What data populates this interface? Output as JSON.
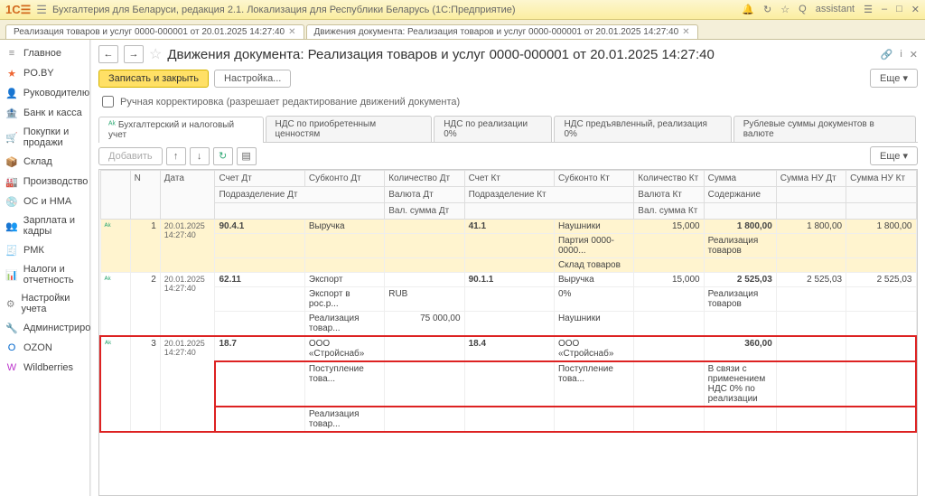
{
  "title": "Бухгалтерия для Беларуси, редакция 2.1. Локализация для Республики Беларусь  (1С:Предприятие)",
  "assistant": "assistant",
  "tabs": [
    "Реализация товаров и услуг 0000-000001 от 20.01.2025 14:27:40",
    "Движения документа: Реализация товаров и услуг 0000-000001 от 20.01.2025 14:27:40"
  ],
  "sidebar": [
    {
      "ico": "≡",
      "label": "Главное",
      "c": "#888"
    },
    {
      "ico": "★",
      "label": "PO.BY",
      "c": "#e63"
    },
    {
      "ico": "👤",
      "label": "Руководителю",
      "c": "#c6a"
    },
    {
      "ico": "🏦",
      "label": "Банк и касса",
      "c": "#f90"
    },
    {
      "ico": "🛒",
      "label": "Покупки и продажи",
      "c": "#3a7"
    },
    {
      "ico": "📦",
      "label": "Склад",
      "c": "#a66"
    },
    {
      "ico": "🏭",
      "label": "Производство",
      "c": "#888"
    },
    {
      "ico": "💿",
      "label": "ОС и НМА",
      "c": "#d44"
    },
    {
      "ico": "👥",
      "label": "Зарплата и кадры",
      "c": "#39c"
    },
    {
      "ico": "🧾",
      "label": "РМК",
      "c": "#6a3"
    },
    {
      "ico": "📊",
      "label": "Налоги и отчетность",
      "c": "#e63"
    },
    {
      "ico": "⚙",
      "label": "Настройки учета",
      "c": "#888"
    },
    {
      "ico": "🔧",
      "label": "Администрирование",
      "c": "#888"
    },
    {
      "ico": "O",
      "label": "OZON",
      "c": "#06c"
    },
    {
      "ico": "W",
      "label": "Wildberries",
      "c": "#b3c"
    }
  ],
  "doc_title": "Движения документа: Реализация товаров и услуг 0000-000001 от 20.01.2025 14:27:40",
  "btn_save": "Записать и закрыть",
  "btn_settings": "Настройка...",
  "btn_more": "Еще",
  "chk_label": "Ручная корректировка (разрешает редактирование движений документа)",
  "subtabs": [
    "Бухгалтерский и налоговый учет",
    "НДС по приобретенным ценностям",
    "НДС по реализации 0%",
    "НДС предъявленный, реализация 0%",
    "Рублевые суммы документов в валюте"
  ],
  "btn_add": "Добавить",
  "headers": {
    "n": "N",
    "date": "Дата",
    "acc_dt": "Счет Дт",
    "sub_dt": "Субконто Дт",
    "qty_dt": "Количество Дт",
    "acc_kt": "Счет Кт",
    "sub_kt": "Субконто Кт",
    "qty_kt": "Количество Кт",
    "sum": "Сумма",
    "sum_nu_dt": "Сумма НУ Дт",
    "sum_nu_kt": "Сумма НУ Кт",
    "podr_dt": "Подразделение Дт",
    "val_dt": "Валюта Дт",
    "valsum_dt": "Вал. сумма Дт",
    "podr_kt": "Подразделение Кт",
    "val_kt": "Валюта Кт",
    "valsum_kt": "Вал. сумма Кт",
    "content": "Содержание"
  },
  "rows": [
    {
      "n": "1",
      "date": "20.01.2025 14:27:40",
      "acc_dt": "90.4.1",
      "sub_dt": [
        "Выручка",
        "",
        ""
      ],
      "qty_dt": [
        "",
        "",
        ""
      ],
      "acc_kt": "41.1",
      "sub_kt": [
        "Наушники",
        "Партия 0000-0000...",
        "Склад товаров"
      ],
      "qty_kt": "15,000",
      "sum": "1 800,00",
      "content": "Реализация товаров",
      "nu_dt": "1 800,00",
      "nu_kt": "1 800,00",
      "sel": true
    },
    {
      "n": "2",
      "date": "20.01.2025 14:27:40",
      "acc_dt": "62.11",
      "sub_dt": [
        "Экспорт",
        "Экспорт в рос.р...",
        "Реализация товар..."
      ],
      "qty_dt": [
        "",
        "RUB",
        "75 000,00"
      ],
      "acc_kt": "90.1.1",
      "sub_kt": [
        "Выручка",
        "0%",
        "Наушники"
      ],
      "qty_kt": "15,000",
      "sum": "2 525,03",
      "content": "Реализация товаров",
      "nu_dt": "2 525,03",
      "nu_kt": "2 525,03"
    },
    {
      "n": "3",
      "date": "20.01.2025 14:27:40",
      "acc_dt": "18.7",
      "sub_dt": [
        "ООО «Стройснаб»",
        "Поступление това...",
        "Реализация товар..."
      ],
      "qty_dt": [
        "",
        "",
        ""
      ],
      "acc_kt": "18.4",
      "sub_kt": [
        "ООО «Стройснаб»",
        "Поступление това...",
        ""
      ],
      "qty_kt": "",
      "sum": "360,00",
      "content": "В связи с применением НДС 0% по реализации",
      "nu_dt": "",
      "nu_kt": "",
      "red": true
    }
  ]
}
